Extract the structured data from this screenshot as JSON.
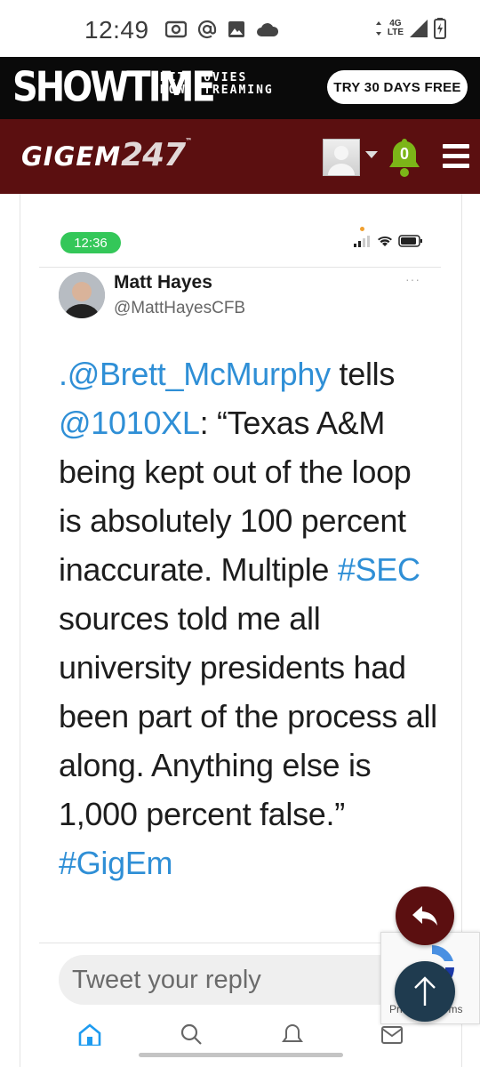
{
  "status_bar": {
    "time": "12:49",
    "network_top": "4G",
    "network_bottom": "LTE"
  },
  "ad": {
    "logo": "SHOWTIME",
    "tagline_line1": "HIT MOVIES",
    "tagline_line2": "NOW STREAMING",
    "cta": "TRY 30 DAYS FREE"
  },
  "site": {
    "logo_text": "GIGEM",
    "logo_number": "247",
    "logo_tm": "™",
    "notification_count": "0",
    "colors": {
      "header": "#5b0f10",
      "bell": "#7cb518"
    }
  },
  "embed": {
    "time": "12:36",
    "status_colors": {
      "time_pill": "#34c759"
    }
  },
  "tweet": {
    "author_name": "Matt Hayes",
    "author_handle": "@MattHayesCFB",
    "more": "···",
    "text": {
      "mention1": ".@Brett_McMurphy",
      "part1": " tells ",
      "mention2": "@1010XL",
      "part2": ": “Texas A&M being kept out of the loop is absolutely 100 percent inaccurate. Multiple ",
      "hashtag1": "#SEC",
      "part3": " sources told me all university presidents had been part of the process all along. Anything else is 1,000 percent false.” ",
      "hashtag2": "#GigEm"
    },
    "link_color": "#2f8fd6"
  },
  "reply": {
    "placeholder": "Tweet your reply"
  },
  "recaptcha": {
    "terms": "Privacy - Terms"
  }
}
